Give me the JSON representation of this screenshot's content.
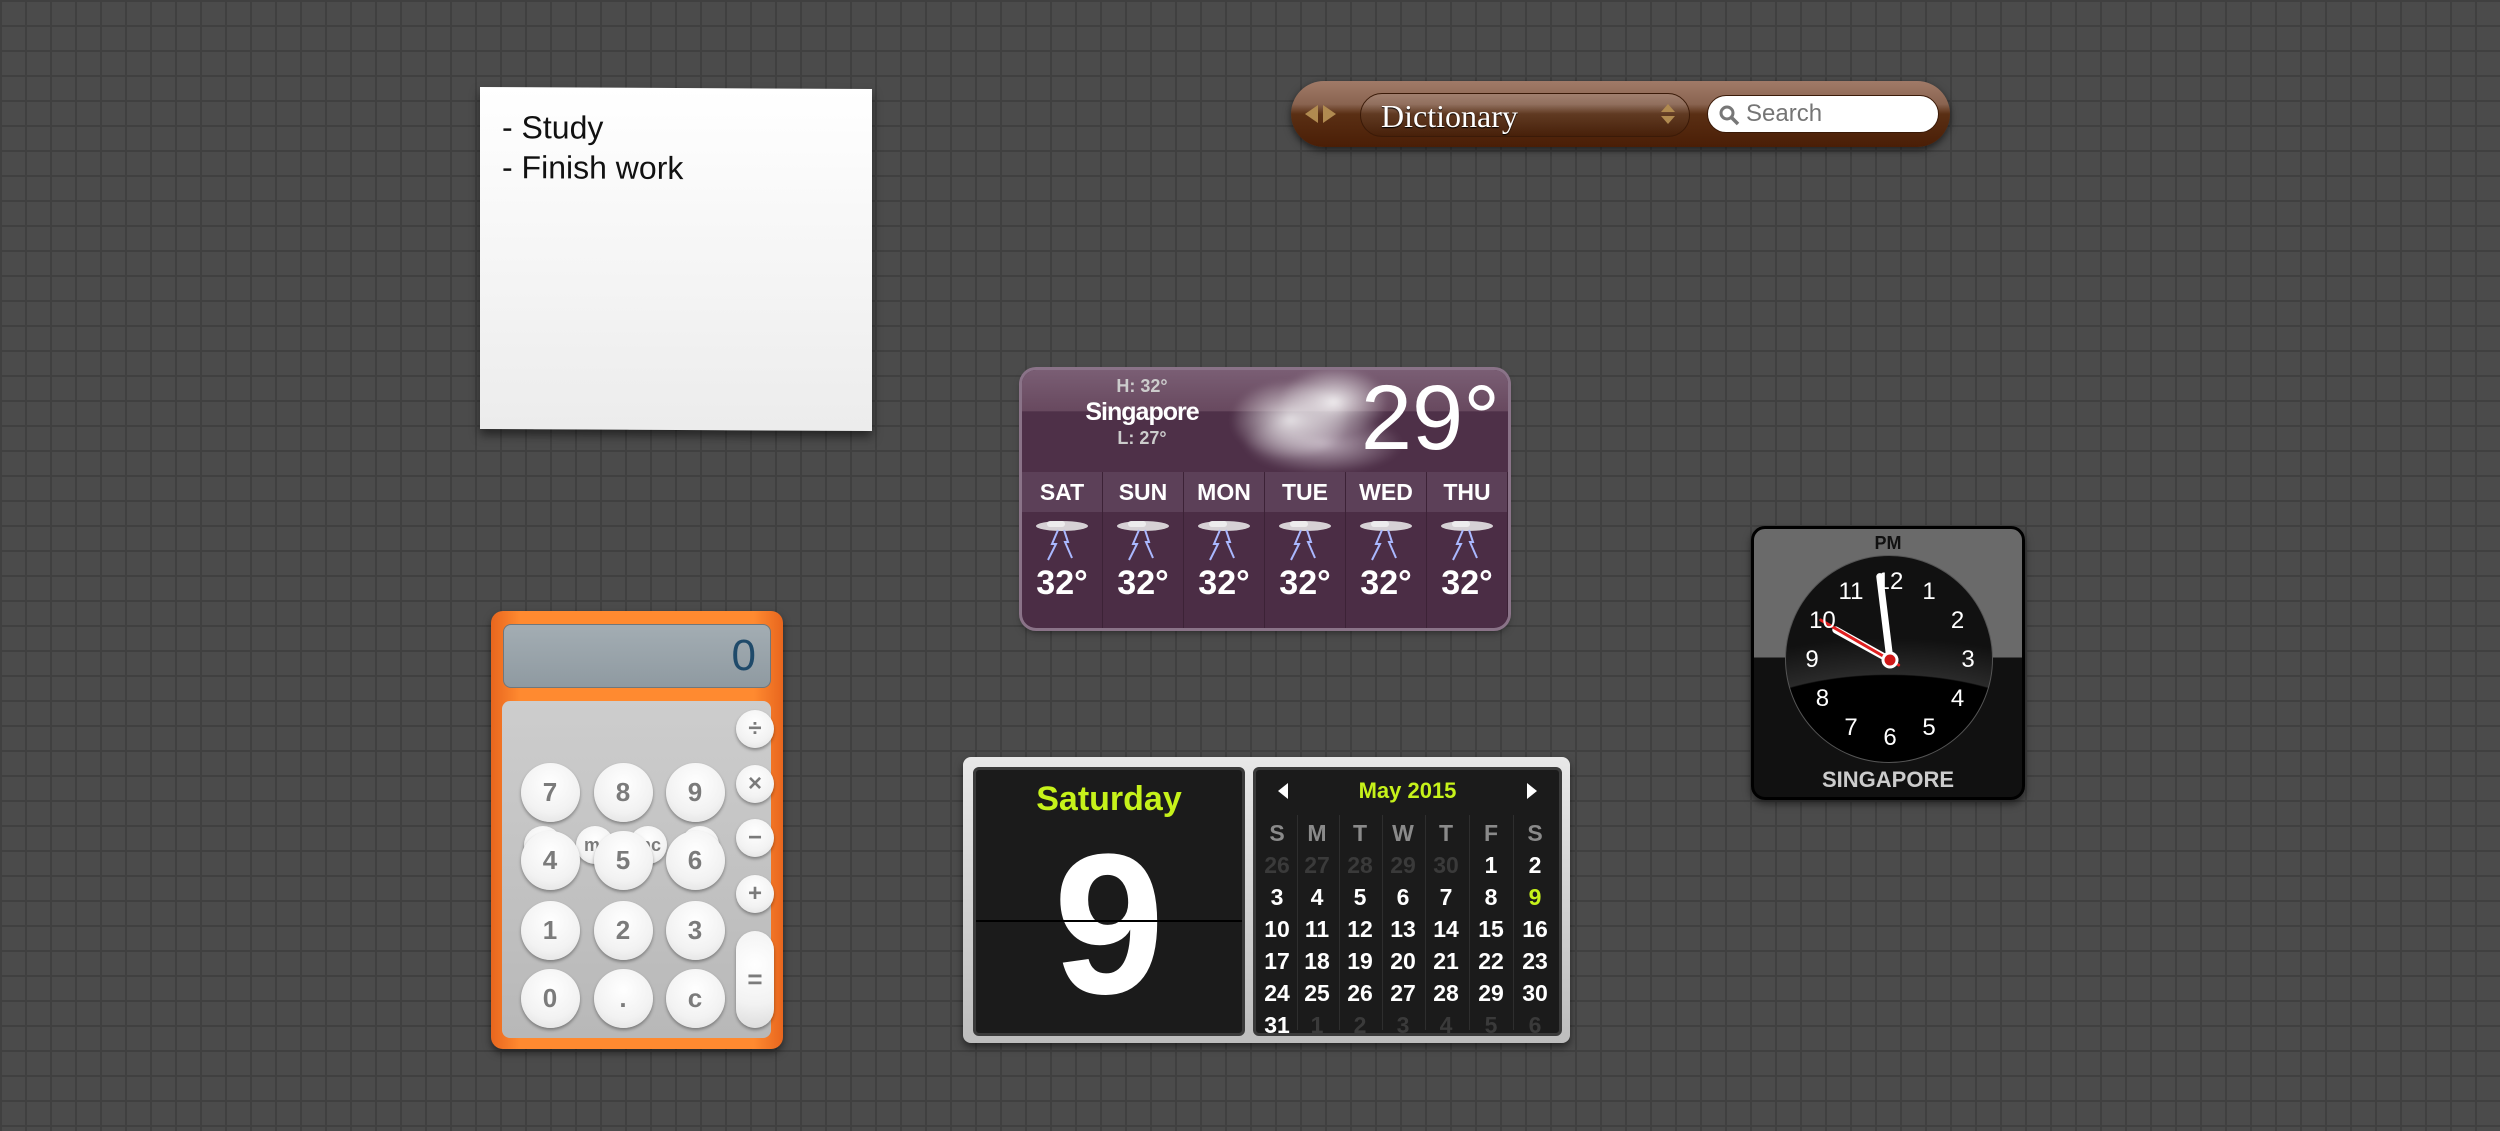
{
  "sticky_note": {
    "lines": [
      "- Study",
      "- Finish work"
    ]
  },
  "dictionary": {
    "source": "Dictionary",
    "search_placeholder": "Search",
    "accent": "#5a2f14"
  },
  "weather": {
    "city": "Singapore",
    "high": "H: 32°",
    "low": "L: 27°",
    "current": "29°",
    "current_icon": "cloud-icon",
    "forecast": [
      {
        "day": "SAT",
        "temp": "32°",
        "icon": "thunderstorm-icon"
      },
      {
        "day": "SUN",
        "temp": "32°",
        "icon": "thunderstorm-icon"
      },
      {
        "day": "MON",
        "temp": "32°",
        "icon": "thunderstorm-icon"
      },
      {
        "day": "TUE",
        "temp": "32°",
        "icon": "thunderstorm-icon"
      },
      {
        "day": "WED",
        "temp": "32°",
        "icon": "thunderstorm-icon"
      },
      {
        "day": "THU",
        "temp": "32°",
        "icon": "thunderstorm-icon"
      }
    ]
  },
  "calculator": {
    "display": "0",
    "memory": [
      "m+",
      "m-",
      "mc",
      "mr"
    ],
    "operators": [
      "÷",
      "×",
      "−",
      "+"
    ],
    "digits": [
      [
        "7",
        "8",
        "9"
      ],
      [
        "4",
        "5",
        "6"
      ],
      [
        "1",
        "2",
        "3"
      ],
      [
        "0",
        ".",
        "c"
      ]
    ],
    "equals": "=",
    "accent": "#ff8a30"
  },
  "calendar": {
    "weekday": "Saturday",
    "day": "9",
    "month": "May 2015",
    "accent": "#c6f21a",
    "dow": [
      "S",
      "M",
      "T",
      "W",
      "T",
      "F",
      "S"
    ],
    "weeks": [
      [
        [
          "26",
          0
        ],
        [
          "27",
          0
        ],
        [
          "28",
          0
        ],
        [
          "29",
          0
        ],
        [
          "30",
          0
        ],
        [
          "1",
          1
        ],
        [
          "2",
          1
        ]
      ],
      [
        [
          "3",
          1
        ],
        [
          "4",
          1
        ],
        [
          "5",
          1
        ],
        [
          "6",
          1
        ],
        [
          "7",
          1
        ],
        [
          "8",
          1
        ],
        [
          "9",
          2
        ]
      ],
      [
        [
          "10",
          1
        ],
        [
          "11",
          1
        ],
        [
          "12",
          1
        ],
        [
          "13",
          1
        ],
        [
          "14",
          1
        ],
        [
          "15",
          1
        ],
        [
          "16",
          1
        ]
      ],
      [
        [
          "17",
          1
        ],
        [
          "18",
          1
        ],
        [
          "19",
          1
        ],
        [
          "20",
          1
        ],
        [
          "21",
          1
        ],
        [
          "22",
          1
        ],
        [
          "23",
          1
        ]
      ],
      [
        [
          "24",
          1
        ],
        [
          "25",
          1
        ],
        [
          "26",
          1
        ],
        [
          "27",
          1
        ],
        [
          "28",
          1
        ],
        [
          "29",
          1
        ],
        [
          "30",
          1
        ]
      ],
      [
        [
          "31",
          1
        ],
        [
          "1",
          0
        ],
        [
          "2",
          0
        ],
        [
          "3",
          0
        ],
        [
          "4",
          0
        ],
        [
          "5",
          0
        ],
        [
          "6",
          0
        ]
      ]
    ]
  },
  "clock": {
    "period": "PM",
    "city": "SINGAPORE",
    "numerals": [
      "12",
      "1",
      "2",
      "3",
      "4",
      "5",
      "6",
      "7",
      "8",
      "9",
      "10",
      "11"
    ],
    "time": {
      "hour": 9,
      "minute": 58,
      "second": 50
    }
  }
}
